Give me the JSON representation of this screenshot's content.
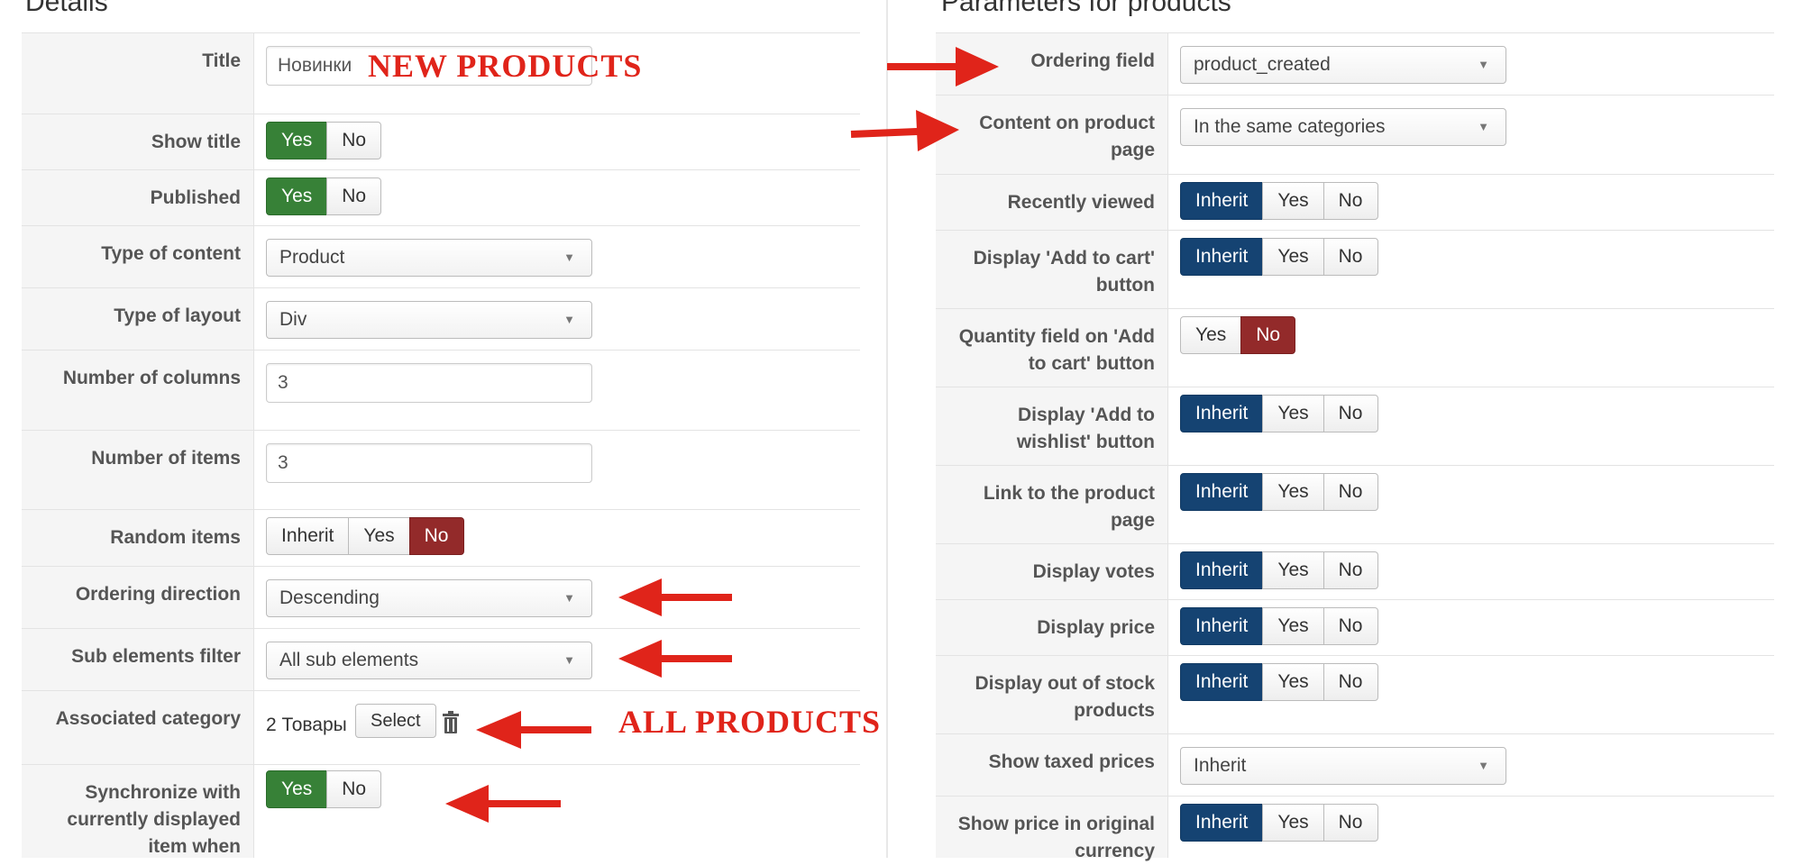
{
  "left_panel": {
    "title": "Details",
    "fields": {
      "title": {
        "label": "Title",
        "value": "Новинки"
      },
      "show_title": {
        "label": "Show title",
        "options": [
          "Yes",
          "No"
        ],
        "selected": "Yes"
      },
      "published": {
        "label": "Published",
        "options": [
          "Yes",
          "No"
        ],
        "selected": "Yes"
      },
      "type_of_content": {
        "label": "Type of content",
        "value": "Product"
      },
      "type_of_layout": {
        "label": "Type of layout",
        "value": "Div"
      },
      "number_of_columns": {
        "label": "Number of columns",
        "value": "3"
      },
      "number_of_items": {
        "label": "Number of items",
        "value": "3"
      },
      "random_items": {
        "label": "Random items",
        "options": [
          "Inherit",
          "Yes",
          "No"
        ],
        "selected": "No"
      },
      "ordering_direction": {
        "label": "Ordering direction",
        "value": "Descending"
      },
      "sub_elements_filter": {
        "label": "Sub elements filter",
        "value": "All sub elements"
      },
      "associated_category": {
        "label": "Associated category",
        "value": "2 Товары",
        "button": "Select"
      },
      "synchronize": {
        "label": "Synchronize with currently displayed item when",
        "options": [
          "Yes",
          "No"
        ],
        "selected": "Yes"
      }
    }
  },
  "right_panel": {
    "title": "Parameters for products",
    "fields": {
      "ordering_field": {
        "label": "Ordering field",
        "value": "product_created"
      },
      "content_on_product_page": {
        "label": "Content on product page",
        "value": "In the same categories"
      },
      "recently_viewed": {
        "label": "Recently viewed",
        "options": [
          "Inherit",
          "Yes",
          "No"
        ],
        "selected": "Inherit"
      },
      "display_add_to_cart": {
        "label": "Display 'Add to cart' button",
        "options": [
          "Inherit",
          "Yes",
          "No"
        ],
        "selected": "Inherit"
      },
      "quantity_field": {
        "label": "Quantity field on 'Add to cart' button",
        "options": [
          "Yes",
          "No"
        ],
        "selected": "No"
      },
      "display_add_to_wishlist": {
        "label": "Display 'Add to wishlist' button",
        "options": [
          "Inherit",
          "Yes",
          "No"
        ],
        "selected": "Inherit"
      },
      "link_to_product_page": {
        "label": "Link to the product page",
        "options": [
          "Inherit",
          "Yes",
          "No"
        ],
        "selected": "Inherit"
      },
      "display_votes": {
        "label": "Display votes",
        "options": [
          "Inherit",
          "Yes",
          "No"
        ],
        "selected": "Inherit"
      },
      "display_price": {
        "label": "Display price",
        "options": [
          "Inherit",
          "Yes",
          "No"
        ],
        "selected": "Inherit"
      },
      "display_out_of_stock": {
        "label": "Display out of stock products",
        "options": [
          "Inherit",
          "Yes",
          "No"
        ],
        "selected": "Inherit"
      },
      "show_taxed_prices": {
        "label": "Show taxed prices",
        "value": "Inherit"
      },
      "show_price_original_currency": {
        "label": "Show price in original currency",
        "options": [
          "Inherit",
          "Yes",
          "No"
        ],
        "selected": "Inherit"
      }
    }
  },
  "annotations": {
    "new_products": "NEW PRODUCTS",
    "all_products": "ALL PRODUCTS",
    "color": "#e0241a"
  },
  "colors": {
    "green": "#378137",
    "blue": "#154372",
    "red": "#932a2a",
    "label_bg": "#f5f5f5"
  },
  "icons": {
    "caret": "chevron-down-icon",
    "delete": "trash-icon"
  }
}
